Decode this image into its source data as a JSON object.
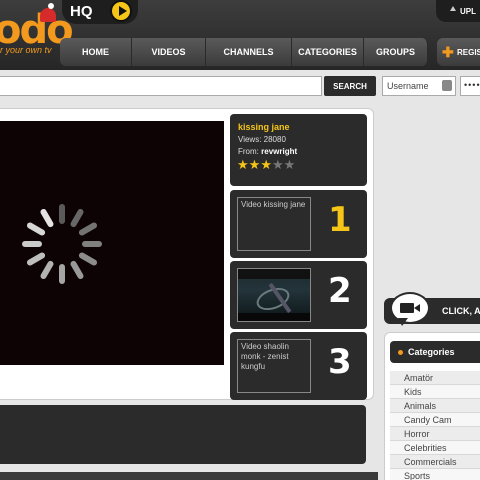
{
  "brand": {
    "logo_text": "odo",
    "tagline": "r your own tv",
    "hq_label": "HQ"
  },
  "header": {
    "upload_label": "UPL",
    "register_label": "REGIS"
  },
  "nav": {
    "items": [
      {
        "label": "HOME"
      },
      {
        "label": "VIDEOS"
      },
      {
        "label": "CHANNELS"
      },
      {
        "label": "CATEGORIES"
      },
      {
        "label": "GROUPS"
      }
    ]
  },
  "search": {
    "button_label": "SEARCH",
    "username_placeholder": "Username",
    "password_value": "••••"
  },
  "player": {
    "state": "loading"
  },
  "video_info": {
    "title": "kissing jane",
    "views": "Views: 28080",
    "from_label": "From:",
    "from_user": "revwright",
    "rating": 3,
    "max_rating": 5
  },
  "related": [
    {
      "number": "1",
      "thumb_alt": "Video kissing jane",
      "has_image": false,
      "number_color": "#f5c518"
    },
    {
      "number": "2",
      "thumb_alt": "",
      "has_image": true,
      "number_color": "#ffffff"
    },
    {
      "number": "3",
      "thumb_alt": "Video shaolin monk - zenist kungfu",
      "has_image": false,
      "number_color": "#ffffff"
    }
  ],
  "sidebar": {
    "click_label": "CLICK, A",
    "categories_title": "Categories",
    "categories": [
      "Amatör",
      "Kids",
      "Animals",
      "Candy Cam",
      "Horror",
      "Celebrities",
      "Commercials",
      "Sports"
    ]
  },
  "colors": {
    "accent": "#f39a1e",
    "gold": "#f5c518",
    "dark_panel": "#2b2b2b"
  }
}
